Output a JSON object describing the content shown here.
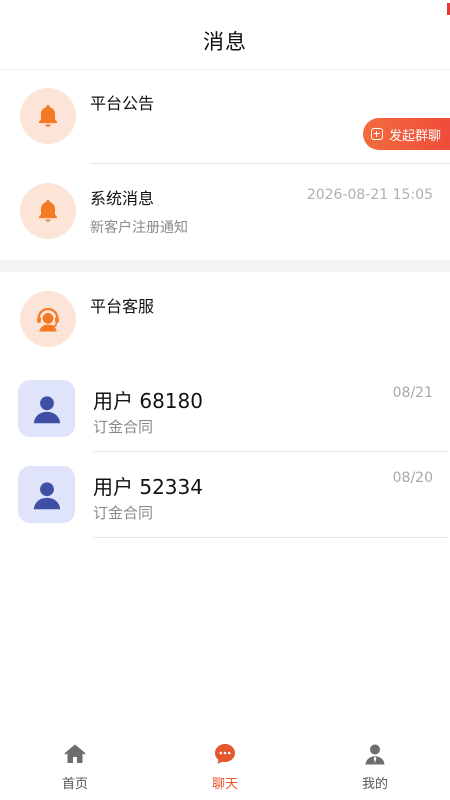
{
  "header": {
    "title": "消息"
  },
  "group_chat_button": {
    "label": "发起群聊"
  },
  "system_rows": [
    {
      "title": "平台公告",
      "subtitle": "",
      "time": "",
      "icon": "bell-icon"
    },
    {
      "title": "系统消息",
      "subtitle": "新客户注册通知",
      "time": "2026-08-21 15:05",
      "icon": "bell-icon"
    },
    {
      "title": "平台客服",
      "subtitle": "",
      "time": "",
      "icon": "customer-service-icon"
    }
  ],
  "chats": [
    {
      "name": "用户 68180",
      "preview": "订金合同",
      "date": "08/21",
      "icon": "user-icon"
    },
    {
      "name": "用户 52334",
      "preview": "订金合同",
      "date": "08/20",
      "icon": "user-icon"
    }
  ],
  "bottom_nav": [
    {
      "label": "首页",
      "icon": "home-icon",
      "active": false
    },
    {
      "label": "聊天",
      "icon": "chat-icon",
      "active": true
    },
    {
      "label": "我的",
      "icon": "profile-icon",
      "active": false
    }
  ],
  "colors": {
    "accent": "#e5572f",
    "button_gradient_start": "#f36c3d",
    "button_gradient_end": "#f04a3b",
    "system_avatar_bg": "#fde4d9",
    "user_avatar_bg": "#dfe4fb",
    "user_avatar_fg": "#3f4fa3"
  }
}
